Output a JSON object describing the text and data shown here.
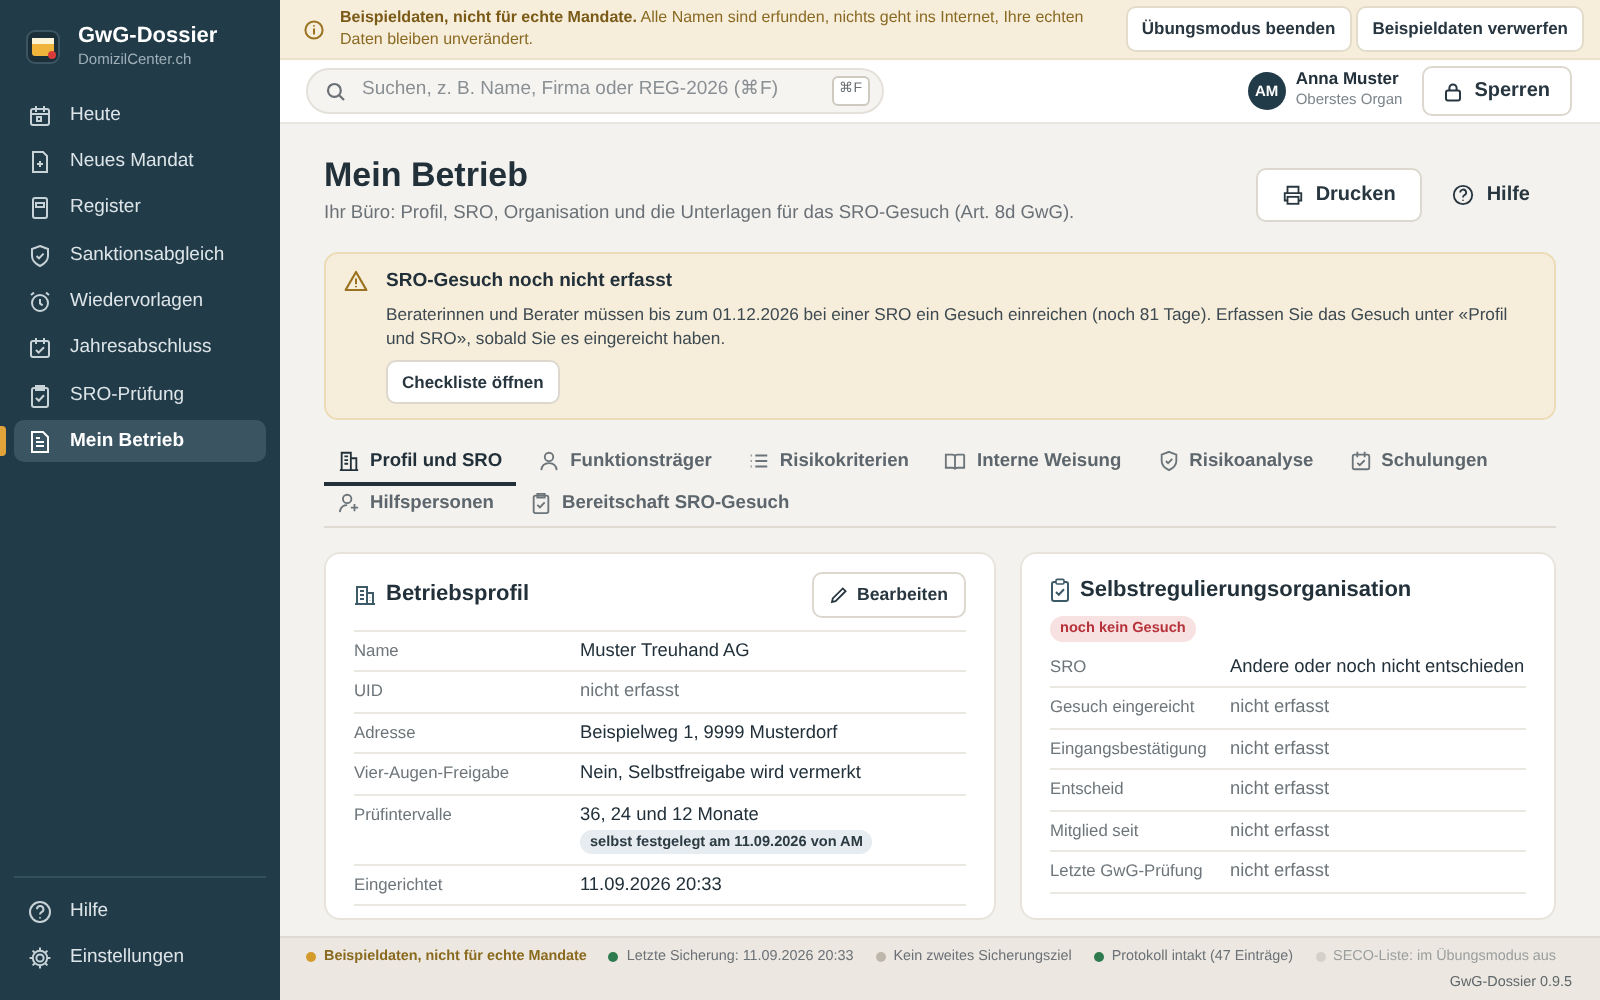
{
  "app": {
    "name": "GwG-Dossier",
    "domain": "DomizilCenter.ch"
  },
  "sidebar": {
    "items": [
      {
        "label": "Heute",
        "selected": false
      },
      {
        "label": "Neues Mandat",
        "selected": false
      },
      {
        "label": "Register",
        "selected": false
      },
      {
        "label": "Sanktionsabgleich",
        "selected": false
      },
      {
        "label": "Wiedervorlagen",
        "selected": false
      },
      {
        "label": "Jahresabschluss",
        "selected": false
      },
      {
        "label": "SRO-Prüfung",
        "selected": false
      },
      {
        "label": "Mein Betrieb",
        "selected": true
      }
    ],
    "footer_items": [
      {
        "label": "Hilfe"
      },
      {
        "label": "Einstellungen"
      }
    ]
  },
  "banner": {
    "text": "**Beispieldaten, nicht für echte Mandate.** Alle Namen sind erfunden, nichts geht ins Internet, Ihre echten Daten bleiben unverändert.",
    "buttons": [
      "Übungsmodus beenden",
      "Beispieldaten verwerfen"
    ]
  },
  "search": {
    "placeholder": "Suchen, z. B. Name, Firma oder REG-2026 (⌘F)",
    "shortcut": "⌘F"
  },
  "user": {
    "initials": "AM",
    "name": "Anna Muster",
    "role": "Oberstes Organ"
  },
  "lock_button": "Sperren",
  "page": {
    "title": "Mein Betrieb",
    "subtitle": "Ihr Büro: Profil, SRO, Organisation und die Unterlagen für das SRO-Gesuch (Art. 8d GwG).",
    "actions": [
      {
        "label": "Drucken",
        "kind": "outline"
      },
      {
        "label": "Hilfe",
        "kind": "plain"
      }
    ]
  },
  "alert": {
    "title": "SRO-Gesuch noch nicht erfasst",
    "text": "Beraterinnen und Berater müssen bis zum 01.12.2026 bei einer SRO ein Gesuch einreichen (noch 81 Tage). Erfassen Sie das Gesuch unter «Profil und SRO», sobald Sie es eingereicht haben.",
    "button": "Checkliste öffnen"
  },
  "tabs": [
    {
      "label": "Profil und SRO",
      "selected": true
    },
    {
      "label": "Funktionsträger",
      "selected": false
    },
    {
      "label": "Risikokriterien",
      "selected": false
    },
    {
      "label": "Interne Weisung",
      "selected": false
    },
    {
      "label": "Risikoanalyse",
      "selected": false
    },
    {
      "label": "Schulungen",
      "selected": false
    },
    {
      "label": "Hilfspersonen",
      "selected": false
    },
    {
      "label": "Bereitschaft SRO-Gesuch",
      "selected": false
    }
  ],
  "profile_card": {
    "title": "Betriebsprofil",
    "button": "Bearbeiten",
    "rows": [
      {
        "label": "Name",
        "value": "Muster Treuhand AG",
        "muted": false
      },
      {
        "label": "UID",
        "value": "nicht erfasst",
        "muted": true
      },
      {
        "label": "Adresse",
        "value": "Beispielweg 1, 9999 Musterdorf",
        "muted": false
      },
      {
        "label": "Vier-Augen-Freigabe",
        "value": "Nein, Selbstfreigabe wird vermerkt",
        "muted": false
      },
      {
        "label": "Prüfintervalle",
        "value": "36, 24 und 12 Monate",
        "muted": false,
        "note": "selbst festgelegt am 11.09.2026 von AM"
      },
      {
        "label": "Eingerichtet",
        "value": "11.09.2026 20:33",
        "muted": false
      }
    ]
  },
  "sro_card": {
    "title": "Selbstregulierungsorganisation",
    "status": "noch kein Gesuch",
    "rows": [
      {
        "label": "SRO",
        "value": "Andere oder noch nicht entschieden",
        "muted": false
      },
      {
        "label": "Gesuch eingereicht",
        "value": "nicht erfasst",
        "muted": true
      },
      {
        "label": "Eingangsbestätigung",
        "value": "nicht erfasst",
        "muted": true
      },
      {
        "label": "Entscheid",
        "value": "nicht erfasst",
        "muted": true
      },
      {
        "label": "Mitglied seit",
        "value": "nicht erfasst",
        "muted": true
      },
      {
        "label": "Letzte GwG-Prüfung",
        "value": "nicht erfasst",
        "muted": true
      }
    ]
  },
  "status_bar": {
    "items": [
      {
        "text": "Beispieldaten, nicht für echte Mandate",
        "color": "#d49a2a",
        "kind": "warning"
      },
      {
        "text": "Letzte Sicherung: 11.09.2026 20:33",
        "color": "#2f7a4f",
        "kind": "normal"
      },
      {
        "text": "Kein zweites Sicherungsziel",
        "color": "#bdb7ab",
        "kind": "normal"
      },
      {
        "text": "Protokoll intakt (47 Einträge)",
        "color": "#2f7a4f",
        "kind": "normal"
      },
      {
        "text": "SECO-Liste: im Übungsmodus aus",
        "color": "#d6d1c8",
        "kind": "off"
      }
    ],
    "version": "GwG-Dossier 0.9.5"
  }
}
